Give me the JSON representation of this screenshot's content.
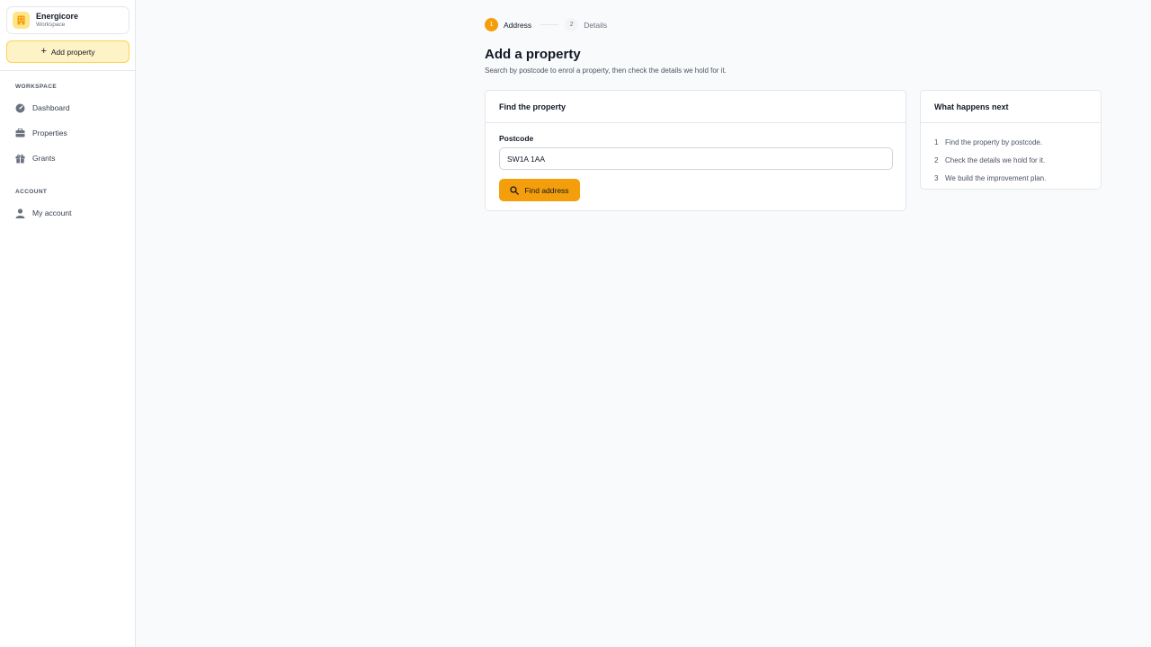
{
  "workspace": {
    "name": "Energicore",
    "subtitle": "Workspace"
  },
  "sidebar": {
    "add_property_label": "Add property",
    "sections": [
      {
        "heading": "WORKSPACE",
        "items": [
          {
            "label": "Dashboard",
            "icon": "dashboard-icon"
          },
          {
            "label": "Properties",
            "icon": "properties-icon"
          },
          {
            "label": "Grants",
            "icon": "gift-icon"
          }
        ]
      },
      {
        "heading": "ACCOUNT",
        "items": [
          {
            "label": "My account",
            "icon": "user-icon"
          }
        ]
      }
    ]
  },
  "stepper": {
    "steps": [
      {
        "number": "1",
        "label": "Address",
        "active": true
      },
      {
        "number": "2",
        "label": "Details",
        "active": false
      }
    ]
  },
  "page": {
    "title": "Add a property",
    "subtitle": "Search by postcode to enrol a property, then check the details we hold for it."
  },
  "find_card": {
    "title": "Find the property",
    "field_label": "Postcode",
    "postcode_value": "SW1A 1AA",
    "button_label": "Find address"
  },
  "next_card": {
    "title": "What happens next",
    "items": [
      {
        "number": "1",
        "text": "Find the property by postcode."
      },
      {
        "number": "2",
        "text": "Check the details we hold for it."
      },
      {
        "number": "3",
        "text": "We build the improvement plan."
      }
    ]
  },
  "colors": {
    "accent": "#f59e0b",
    "accent_soft": "#fef3c7",
    "border": "#e5e7eb",
    "background": "#f9fafb"
  }
}
